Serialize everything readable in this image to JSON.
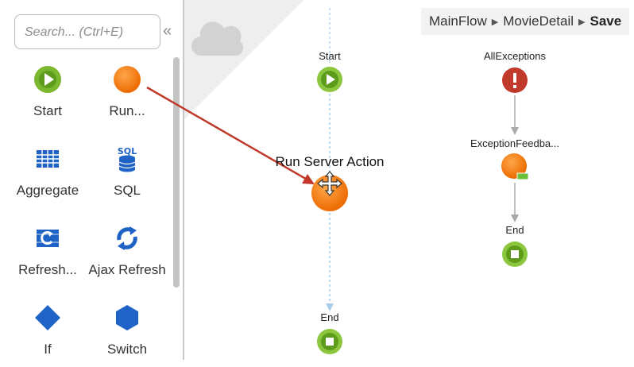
{
  "toolbox": {
    "search_placeholder": "Search... (Ctrl+E)",
    "collapse_glyph": "«",
    "tools": [
      {
        "label": "Start",
        "icon": "start-icon"
      },
      {
        "label": "Run...",
        "icon": "run-server-action-icon"
      },
      {
        "label": "Aggregate",
        "icon": "aggregate-icon"
      },
      {
        "label": "SQL",
        "icon": "sql-icon"
      },
      {
        "label": "Refresh...",
        "icon": "refresh-data-icon"
      },
      {
        "label": "Ajax Refresh",
        "icon": "ajax-refresh-icon"
      },
      {
        "label": "If",
        "icon": "if-icon"
      },
      {
        "label": "Switch",
        "icon": "switch-icon"
      }
    ]
  },
  "breadcrumb": {
    "items": [
      "MainFlow",
      "MovieDetail"
    ],
    "current": "Save"
  },
  "flow": {
    "start_label": "Start",
    "dragging_label": "Run Server Action",
    "end_label": "End"
  },
  "exception_flow": {
    "handler_label": "AllExceptions",
    "feedback_label": "ExceptionFeedba...",
    "end_label": "End"
  },
  "colors": {
    "start_green": "#7cb82f",
    "action_orange": "#f07c0f",
    "exception_red": "#c0392b",
    "blue_icon": "#1f63c6",
    "arrow_red": "#c0392b",
    "connector_blue": "#a9cdea"
  }
}
